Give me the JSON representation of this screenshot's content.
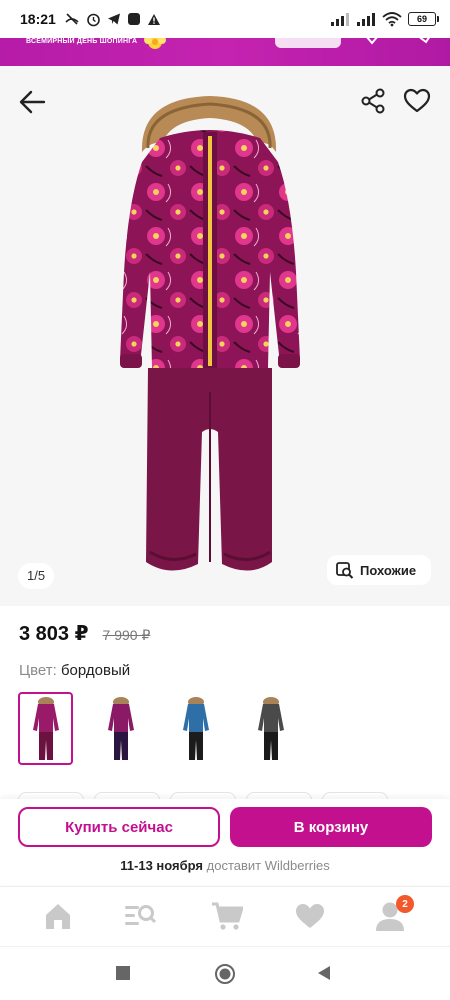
{
  "status_bar": {
    "time": "18:21",
    "battery": "69"
  },
  "promo": {
    "text": "ВСЕМИРНЫЙ ДЕНЬ ШОПИНГА"
  },
  "gallery": {
    "counter": "1/5",
    "similar_label": "Похожие"
  },
  "product": {
    "price": "3 803 ₽",
    "old_price": "7 990 ₽",
    "color_label": "Цвет:",
    "color_value": " бордовый",
    "variants": [
      {
        "name": "burgundy",
        "selected": true,
        "top": "#9a1a6a",
        "bottom": "#6b1240"
      },
      {
        "name": "purple",
        "selected": false,
        "top": "#8a1a66",
        "bottom": "#2a1440"
      },
      {
        "name": "blue",
        "selected": false,
        "top": "#2f6fa8",
        "bottom": "#1c1c1c"
      },
      {
        "name": "grey",
        "selected": false,
        "top": "#4a4a4a",
        "bottom": "#1a1a1a"
      }
    ]
  },
  "actions": {
    "buy_now": "Купить сейчас",
    "to_cart": "В корзину",
    "delivery_dates": "11-13 ноября",
    "delivery_text": " доставит Wildberries"
  },
  "bottom_nav": {
    "items": [
      "home-icon",
      "catalog-search-icon",
      "cart-icon",
      "favorites-icon",
      "profile-icon"
    ],
    "profile_badge": "2"
  },
  "colors": {
    "accent": "#c3108f",
    "promo": "#b51ca8",
    "badge": "#f2582b"
  }
}
